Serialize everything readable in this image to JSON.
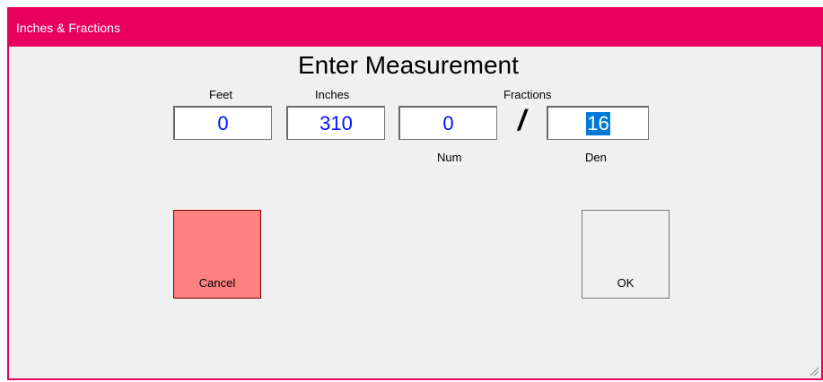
{
  "window": {
    "title": "Inches & Fractions",
    "accent_color": "#e8005f"
  },
  "dialog": {
    "heading": "Enter Measurement",
    "labels": {
      "feet": "Feet",
      "inches": "Inches",
      "fractions": "Fractions",
      "num": "Num",
      "den": "Den"
    },
    "fields": {
      "feet": "0",
      "inches": "310",
      "num": "0",
      "den": "16"
    },
    "separator": "/",
    "value_color": "#0010ff"
  },
  "buttons": {
    "cancel": "Cancel",
    "cancel_color": "#ff8080",
    "ok": "OK"
  },
  "icons": {
    "resize_grip": "resize-grip-icon"
  }
}
